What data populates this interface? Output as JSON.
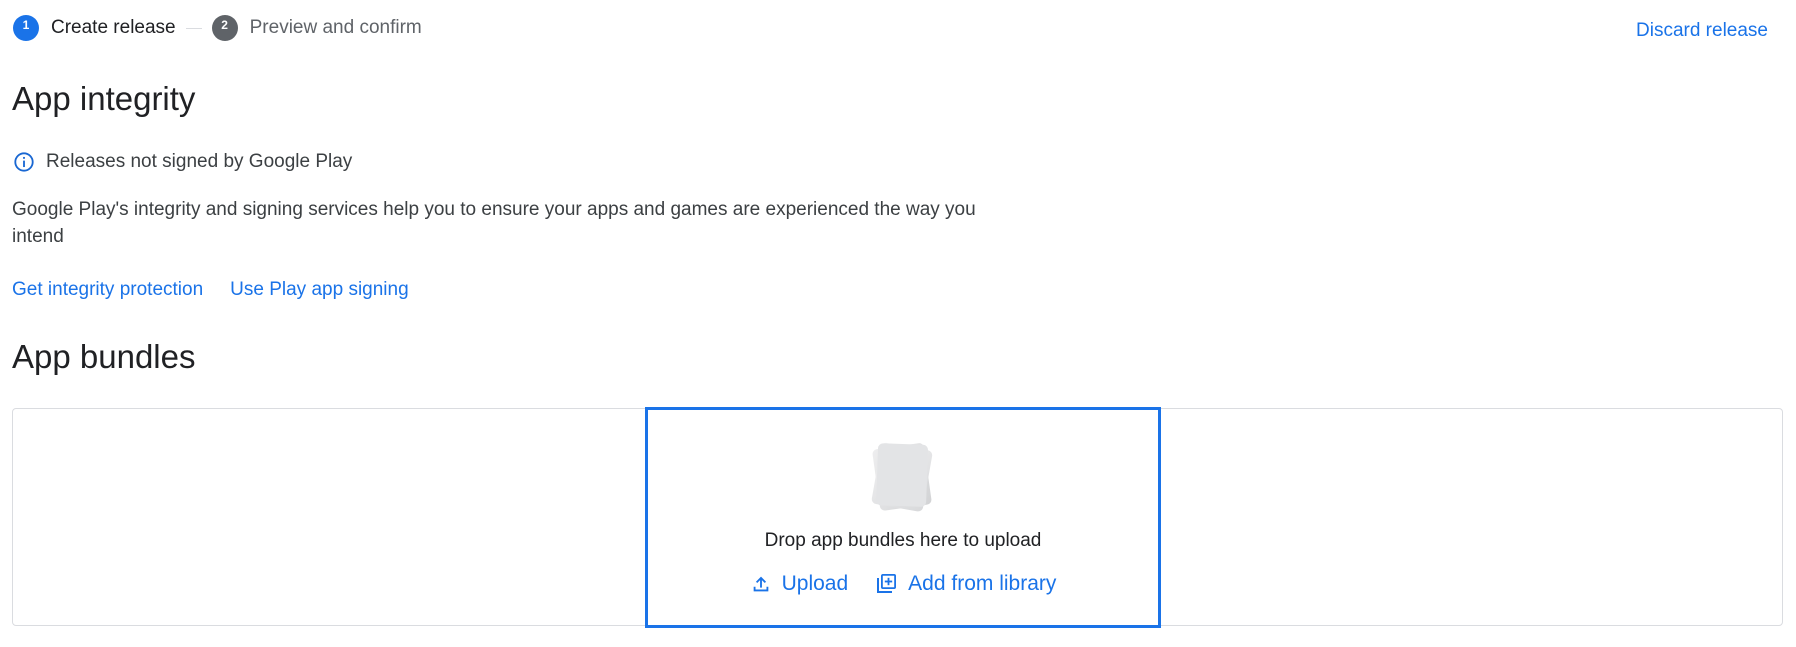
{
  "stepper": {
    "steps": [
      {
        "number": "1",
        "label": "Create release"
      },
      {
        "number": "2",
        "label": "Preview and confirm"
      }
    ]
  },
  "header": {
    "discard_label": "Discard release"
  },
  "integrity": {
    "title": "App integrity",
    "status_icon": "info-icon",
    "status_text": "Releases not signed by Google Play",
    "description": "Google Play's integrity and signing services help you to ensure your apps and games are experienced the way you intend",
    "links": [
      {
        "label": "Get integrity protection"
      },
      {
        "label": "Use Play app signing"
      }
    ]
  },
  "bundles": {
    "title": "App bundles",
    "drop_text": "Drop app bundles here to upload",
    "upload_label": "Upload",
    "upload_icon": "upload-icon",
    "library_label": "Add from library",
    "library_icon": "library-add-icon"
  },
  "colors": {
    "accent": "#1a73e8",
    "step_inactive": "#5f6368",
    "border": "#dadce0"
  }
}
